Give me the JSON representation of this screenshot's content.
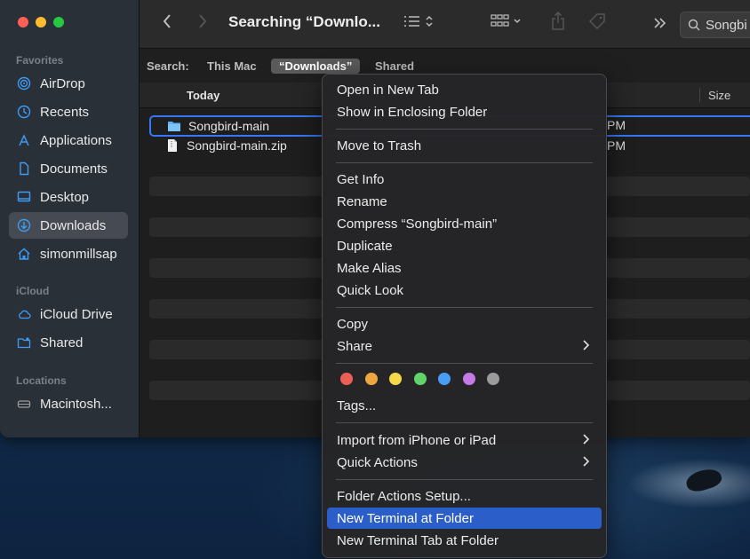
{
  "window": {
    "title": "Searching “Downlo..."
  },
  "search": {
    "value": "Songbi"
  },
  "sidebar": {
    "sections": [
      {
        "label": "Favorites"
      },
      {
        "label": "iCloud"
      },
      {
        "label": "Locations"
      }
    ],
    "items": [
      {
        "label": "AirDrop",
        "icon": "airdrop-icon"
      },
      {
        "label": "Recents",
        "icon": "clock-icon"
      },
      {
        "label": "Applications",
        "icon": "applications-icon"
      },
      {
        "label": "Documents",
        "icon": "document-icon"
      },
      {
        "label": "Desktop",
        "icon": "desktop-icon"
      },
      {
        "label": "Downloads",
        "icon": "download-icon",
        "active": true
      },
      {
        "label": "simonmillsap",
        "icon": "home-icon"
      },
      {
        "label": "iCloud Drive",
        "icon": "cloud-icon"
      },
      {
        "label": "Shared",
        "icon": "shared-folder-icon"
      },
      {
        "label": "Macintosh...",
        "icon": "disk-icon"
      }
    ]
  },
  "scope": {
    "label": "Search:",
    "options": [
      "This Mac",
      "“Downloads”",
      "Shared"
    ],
    "selected": "“Downloads”"
  },
  "list": {
    "header_group": "Today",
    "header_size": "Size",
    "files": [
      {
        "name": "Songbird-main",
        "kind": "folder",
        "time_suffix": "PM"
      },
      {
        "name": "Songbird-main.zip",
        "kind": "zip",
        "time_suffix": "PM"
      }
    ]
  },
  "menu": {
    "items": [
      {
        "label": "Open in New Tab"
      },
      {
        "label": "Show in Enclosing Folder"
      },
      {
        "label": "Move to Trash"
      },
      {
        "label": "Get Info"
      },
      {
        "label": "Rename"
      },
      {
        "label": "Compress “Songbird-main”"
      },
      {
        "label": "Duplicate"
      },
      {
        "label": "Make Alias"
      },
      {
        "label": "Quick Look"
      },
      {
        "label": "Copy"
      },
      {
        "label": "Share",
        "submenu": true
      },
      {
        "label": "Tags..."
      },
      {
        "label": "Import from iPhone or iPad",
        "submenu": true
      },
      {
        "label": "Quick Actions",
        "submenu": true
      },
      {
        "label": "Folder Actions Setup..."
      },
      {
        "label": "New Terminal at Folder",
        "highlighted": true
      },
      {
        "label": "New Terminal Tab at Folder"
      }
    ],
    "tag_colors": [
      "#ec5f57",
      "#f0a640",
      "#f5d94a",
      "#62d36a",
      "#4a9df5",
      "#c57ae6",
      "#9b9b9b"
    ]
  },
  "colors": {
    "accent": "#2c5ec9",
    "selection_border": "#3478f6"
  }
}
